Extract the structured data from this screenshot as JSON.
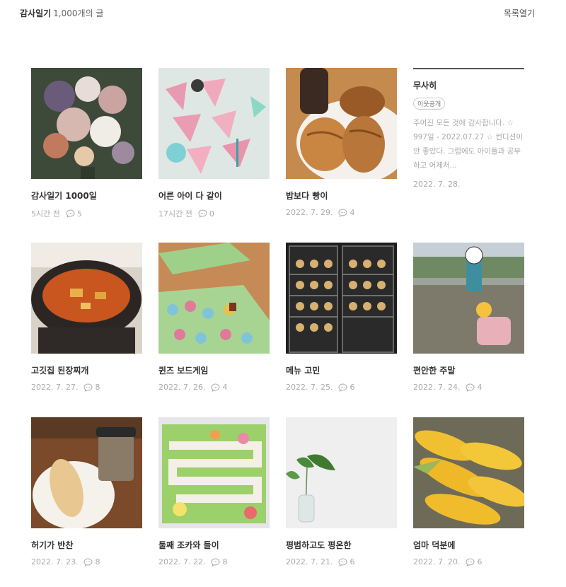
{
  "header": {
    "category_title": "감사일기",
    "post_count": "1,000개의 글",
    "list_toggle": "목록열기"
  },
  "text_card": {
    "title": "무사히",
    "badge": "이웃공개",
    "excerpt": "주어진 모든 것에 감사합니다. ☆ 997일 - 2022.07.27 ☆ 컨디션이 안 좋았다. 그럼에도 아이들과 공부하고 어제처...",
    "date": "2022. 7. 28."
  },
  "posts": [
    {
      "title": "감사일기 1000일",
      "date": "5시간 전",
      "comments": "5",
      "thumb": "flower-bouquet-photo"
    },
    {
      "title": "어른 아이 다 같이",
      "date": "17시간 전",
      "comments": "0",
      "thumb": "party-table-photo"
    },
    {
      "title": "밥보다 빵이",
      "date": "2022. 7. 29.",
      "comments": "4",
      "thumb": "croissant-photo"
    },
    {
      "title": "고깃집 된장찌개",
      "date": "2022. 7. 27.",
      "comments": "8",
      "thumb": "stew-pot-photo"
    },
    {
      "title": "퀸즈 보드게임",
      "date": "2022. 7. 26.",
      "comments": "4",
      "thumb": "board-game-photo"
    },
    {
      "title": "메뉴 고민",
      "date": "2022. 7. 25.",
      "comments": "6",
      "thumb": "food-display-photo"
    },
    {
      "title": "편안한 주말",
      "date": "2022. 7. 24.",
      "comments": "4",
      "thumb": "stream-kids-photo"
    },
    {
      "title": "허기가 반찬",
      "date": "2022. 7. 23.",
      "comments": "8",
      "thumb": "sandwich-coffee-photo"
    },
    {
      "title": "둘째 조카와 들이",
      "date": "2022. 7. 22.",
      "comments": "8",
      "thumb": "kids-game-board-photo"
    },
    {
      "title": "평범하고도 평온한",
      "date": "2022. 7. 21.",
      "comments": "6",
      "thumb": "plant-vase-photo"
    },
    {
      "title": "엄마 덕분에",
      "date": "2022. 7. 20.",
      "comments": "6",
      "thumb": "corn-photo"
    }
  ],
  "icons": {
    "comment": "speech-bubble-icon"
  }
}
